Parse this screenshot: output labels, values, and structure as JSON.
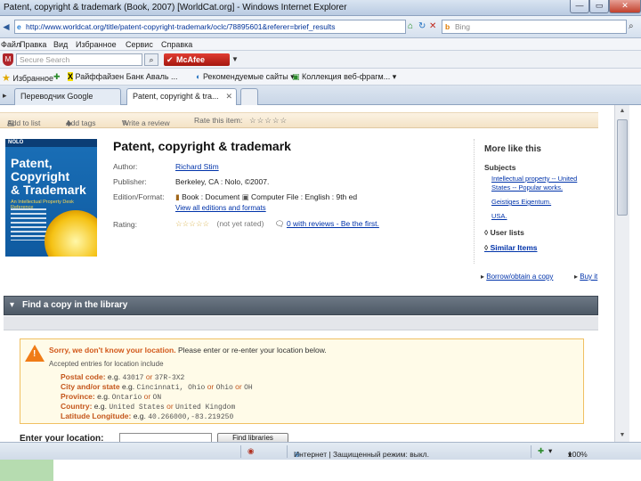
{
  "window": {
    "title": "Patent, copyright & trademark (Book, 2007) [WorldCat.org] - Windows Internet Explorer",
    "min": "—",
    "max": "▭",
    "close": "✕"
  },
  "address": {
    "back": "◄",
    "url": "http://www.worldcat.org/title/patent-copyright-trademark/oclc/78895601&referer=brief_results",
    "search_placeholder": "Bing",
    "refresh": "↻",
    "stop": "✕"
  },
  "menu": [
    "Файл",
    "Правка",
    "Вид",
    "Избранное",
    "Сервис",
    "Справка"
  ],
  "toolbar": {
    "secure_search": "Secure Search",
    "mcafee": "McAfee"
  },
  "favorites": {
    "label": "Избранное",
    "items": [
      "Райффайзен Банк Аваль ...",
      "Рекомендуемые сайты ▾",
      "Коллекция веб-фрагм... ▾"
    ]
  },
  "tabs": [
    {
      "label": "Переводчик Google"
    },
    {
      "label": "Patent, copyright & tra..."
    }
  ],
  "actions": [
    "Add to list",
    "Add tags",
    "Write a review",
    "Rate this item:"
  ],
  "book": {
    "cover_publisher": "NOLO",
    "cover_title_1": "Patent,",
    "cover_title_2": "Copyright",
    "cover_title_3": "& Trademark",
    "cover_subtitle": "An Intellectual Property Desk Reference",
    "title": "Patent, copyright & trademark",
    "author_label": "Author:",
    "author": "Richard Stim",
    "publisher_label": "Publisher:",
    "publisher": "Berkeley, CA : Nolo, ©2007.",
    "edition_label": "Edition/Format:",
    "edition_book": "Book : Document",
    "edition_file": "Computer File : English : 9th ed",
    "view_all": "View all editions and formats",
    "rating_label": "Rating:",
    "rating_stars": "☆☆☆☆☆",
    "not_rated": "(not yet rated)",
    "reviews": "0 with reviews - Be the first."
  },
  "sidebar": {
    "more_like": "More like this",
    "subjects_label": "Subjects",
    "subjects": [
      "Intellectual property -- United",
      "States -- Popular works.",
      "Geistiges Eigentum.",
      "USA."
    ],
    "user_lists": "User lists",
    "similar_items": "Similar Items"
  },
  "links": {
    "borrow": "Borrow/obtain a copy",
    "buy": "Buy it"
  },
  "find_copy": {
    "title": "Find a copy in the library"
  },
  "alert": {
    "bold": "Sorry, we don't know your location.",
    "text": " Please enter or re-enter your location below.",
    "accepted": "Accepted entries for location include",
    "examples": [
      {
        "label": "Postal code:",
        "eg": " e.g. ",
        "v1": "43017",
        "or": " or ",
        "v2": "37R-3X2"
      },
      {
        "label": "City and/or state",
        "eg": " e.g. ",
        "v1": "Cincinnati, Ohio",
        "or": " or ",
        "v2": "Ohio",
        "or2": " or ",
        "v3": "OH"
      },
      {
        "label": "Province:",
        "eg": " e.g. ",
        "v1": "Ontario",
        "or": " or ",
        "v2": "ON"
      },
      {
        "label": "Country:",
        "eg": " e.g. ",
        "v1": "United States",
        "or": " or ",
        "v2": "United Kingdom"
      },
      {
        "label": "Latitude Longitude:",
        "eg": " e.g. ",
        "v1": "40.266000,-83.219250"
      }
    ]
  },
  "location": {
    "label": "Enter your location:",
    "button": "Find libraries"
  },
  "status": {
    "zone": "Интернет | Защищенный режим: выкл.",
    "zoom": "100%"
  }
}
